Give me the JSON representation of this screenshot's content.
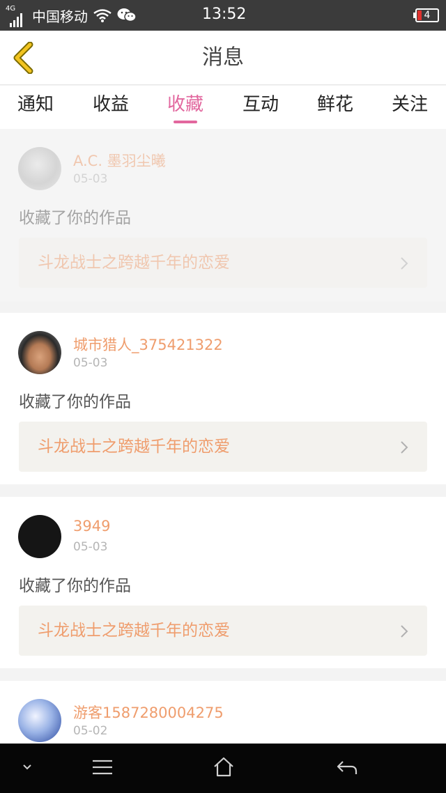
{
  "status": {
    "network": "4G",
    "carrier": "中国移动",
    "time": "13:52",
    "battery": "4"
  },
  "header": {
    "title": "消息"
  },
  "tabs": [
    {
      "label": "通知",
      "active": false
    },
    {
      "label": "收益",
      "active": false
    },
    {
      "label": "收藏",
      "active": true
    },
    {
      "label": "互动",
      "active": false
    },
    {
      "label": "鲜花",
      "active": false
    },
    {
      "label": "关注",
      "active": false
    }
  ],
  "items": [
    {
      "user": "A.C. 墨羽尘曦",
      "date": "05-03",
      "action": "收藏了你的作品",
      "work": "斗龙战士之跨越千年的恋爱"
    },
    {
      "user": "城市猎人_375421322",
      "date": "05-03",
      "action": "收藏了你的作品",
      "work": "斗龙战士之跨越千年的恋爱"
    },
    {
      "user": "3949",
      "date": "05-03",
      "action": "收藏了你的作品",
      "work": "斗龙战士之跨越千年的恋爱"
    },
    {
      "user": "游客1587280004275",
      "date": "05-02"
    }
  ],
  "colors": {
    "accent": "#e2679e",
    "username": "#ef9d6d",
    "back_icon": "#f2c420"
  }
}
